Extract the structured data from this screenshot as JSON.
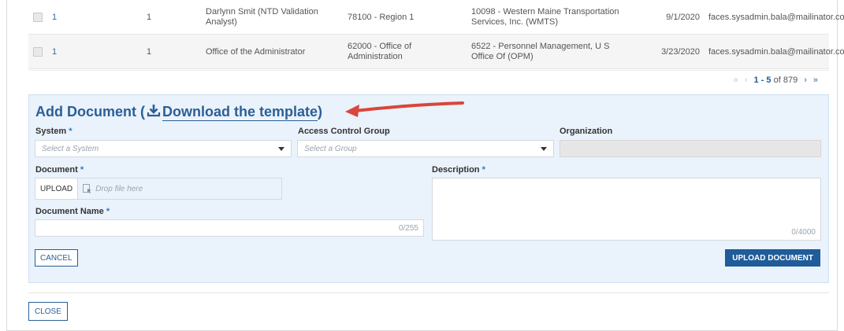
{
  "table": {
    "rows": [
      {
        "col_a": "1",
        "col_b": "1",
        "name": "Darlynn Smit (NTD Validation Analyst)",
        "region": "78100 - Region 1",
        "agency": "10098 - Western Maine Transportation Services, Inc. (WMTS)",
        "date": "9/1/2020",
        "email": "faces.sysadmin.bala@mailinator.com"
      },
      {
        "col_a": "1",
        "col_b": "1",
        "name": "Office of the Administrator",
        "region": "62000 - Office of Administration",
        "agency": "6522 - Personnel Management, U S Office Of (OPM)",
        "date": "3/23/2020",
        "email": "faces.sysadmin.bala@mailinator.com"
      }
    ]
  },
  "pager": {
    "first": "«",
    "prev": "‹",
    "range": "1 - 5",
    "of_text": "of 879",
    "next": "›",
    "last": "»"
  },
  "add_document": {
    "title": "Add Document (",
    "download_link": "Download the template",
    "title_close": ")",
    "system_label": "System",
    "system_placeholder": "Select a System",
    "access_label": "Access Control Group",
    "access_placeholder": "Select a Group",
    "org_label": "Organization",
    "document_label": "Document",
    "upload_button": "UPLOAD",
    "drop_text": "Drop file here",
    "description_label": "Description",
    "description_counter": "0/4000",
    "docname_label": "Document Name",
    "docname_counter": "0/255",
    "cancel_button": "CANCEL",
    "upload_document_button": "UPLOAD DOCUMENT",
    "required_mark": "*"
  },
  "footer": {
    "close_button": "CLOSE"
  },
  "colors": {
    "accent": "#2b5f97",
    "primary_button": "#1f5c99",
    "panel_bg": "#eaf2fb",
    "arrow": "#d9463a"
  },
  "icons": {
    "download": "download-icon",
    "drop": "file-drop-icon",
    "caret": "caret-down-icon"
  }
}
